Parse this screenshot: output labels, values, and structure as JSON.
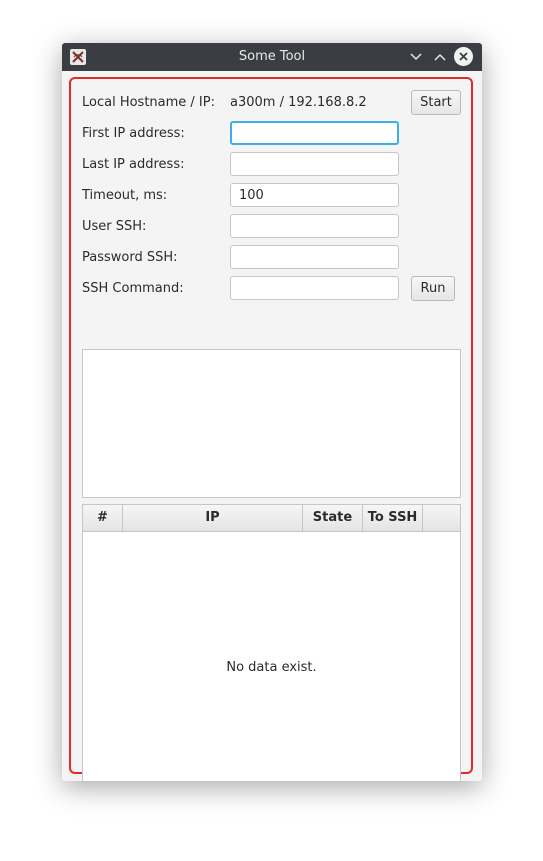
{
  "window": {
    "title": "Some Tool"
  },
  "form": {
    "hostname_label": "Local Hostname / IP:",
    "hostname_value": "a300m / 192.168.8.2",
    "start_label": "Start",
    "first_ip_label": "First IP address:",
    "first_ip_value": "",
    "last_ip_label": "Last IP address:",
    "last_ip_value": "",
    "timeout_label": "Timeout, ms:",
    "timeout_value": "100",
    "user_ssh_label": "User SSH:",
    "user_ssh_value": "",
    "password_ssh_label": "Password SSH:",
    "password_ssh_value": "",
    "ssh_command_label": "SSH Command:",
    "ssh_command_value": "",
    "run_label": "Run"
  },
  "table": {
    "columns": [
      "#",
      "IP",
      "State",
      "To SSH"
    ],
    "empty_message": "No data exist."
  },
  "colors": {
    "titlebar": "#3a3d42",
    "focus": "#3daee9",
    "highlight_border": "#e02b2b"
  }
}
